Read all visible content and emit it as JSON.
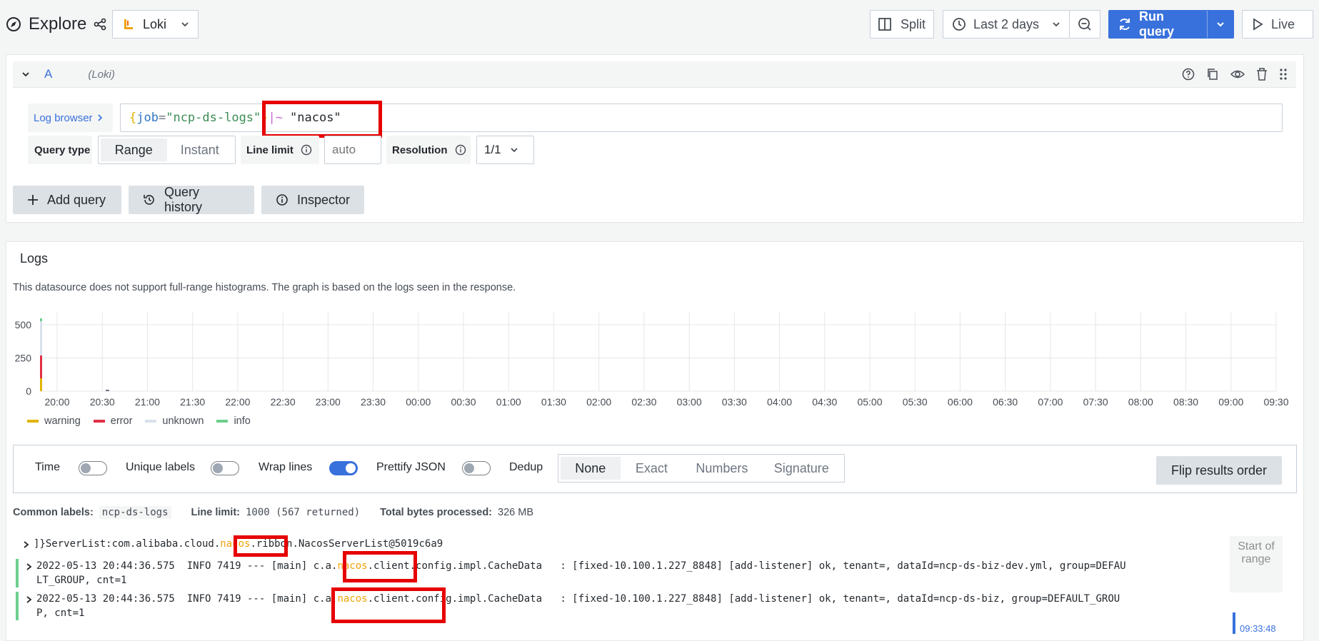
{
  "header": {
    "title": "Explore",
    "datasource": "Loki",
    "split_label": "Split",
    "time_range": "Last 2 days",
    "run_query_label": "Run query",
    "live_label": "Live"
  },
  "query": {
    "ref_id": "A",
    "ds_hint": "(Loki)",
    "log_browser_label": "Log browser",
    "expr": {
      "brace_open": "{",
      "key": "job",
      "eq": "=",
      "value": "\"ncp-ds-logs\"",
      "brace_close": "}",
      "op": "|~",
      "filter": "\"nacos\""
    },
    "query_type_label": "Query type",
    "range_label": "Range",
    "instant_label": "Instant",
    "line_limit_label": "Line limit",
    "line_limit_placeholder": "auto",
    "resolution_label": "Resolution",
    "resolution_value": "1/1"
  },
  "actions": {
    "add_query": "Add query",
    "query_history": "Query history",
    "inspector": "Inspector"
  },
  "logs": {
    "title": "Logs",
    "notice": "This datasource does not support full-range histograms. The graph is based on the logs seen in the response.",
    "y_ticks": [
      "500",
      "250",
      "0"
    ],
    "x_ticks": [
      "20:00",
      "20:30",
      "21:00",
      "21:30",
      "22:00",
      "22:30",
      "23:00",
      "23:30",
      "00:00",
      "00:30",
      "01:00",
      "01:30",
      "02:00",
      "02:30",
      "03:00",
      "03:30",
      "04:00",
      "04:30",
      "05:00",
      "05:30",
      "06:00",
      "06:30",
      "07:00",
      "07:30",
      "08:00",
      "08:30",
      "09:00",
      "09:30"
    ],
    "legend": [
      {
        "name": "warning",
        "color": "#e0b400"
      },
      {
        "name": "error",
        "color": "#e02f44"
      },
      {
        "name": "unknown",
        "color": "#d9e1ec"
      },
      {
        "name": "info",
        "color": "#6ccf8e"
      }
    ],
    "options": {
      "time": "Time",
      "unique_labels": "Unique labels",
      "wrap_lines": "Wrap lines",
      "prettify_json": "Prettify JSON",
      "dedup": "Dedup",
      "dedup_options": [
        "None",
        "Exact",
        "Numbers",
        "Signature"
      ],
      "flip": "Flip results order"
    },
    "meta": {
      "common_labels_key": "Common labels:",
      "common_labels_value": "ncp-ds-logs",
      "line_limit_key": "Line limit:",
      "line_limit_value": "1000 (567 returned)",
      "bytes_key": "Total bytes processed:",
      "bytes_value": "326 MB"
    },
    "lines": [
      {
        "pre": "]}ServerList:com.alibaba.cloud.",
        "hl": "nacos",
        "post": ".ribbon.NacosServerList@5019c6a9",
        "cont": ""
      },
      {
        "pre": "2022-05-13 20:44:36.575  INFO 7419 --- [main] c.a.",
        "hl": "nacos",
        "post": ".client.config.impl.CacheData   : [fixed-10.100.1.227_8848] [add-listener] ok, tenant=, dataId=ncp-ds-biz-dev.yml, group=DEFAU",
        "cont": "LT_GROUP, cnt=1"
      },
      {
        "pre": "2022-05-13 20:44:36.575  INFO 7419 --- [main] c.a.",
        "hl": "nacos",
        "post": ".client.config.impl.CacheData   : [fixed-10.100.1.227_8848] [add-listener] ok, tenant=, dataId=ncp-ds-biz, group=DEFAULT_GROU",
        "cont": "P, cnt=1"
      }
    ],
    "start_of_range": "Start of range",
    "time_marker": "09:33:48"
  }
}
